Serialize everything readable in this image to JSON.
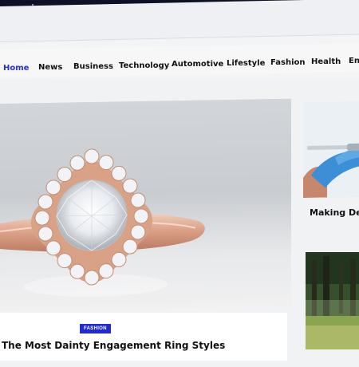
{
  "nav": {
    "items": [
      {
        "label": "Home",
        "active": true
      },
      {
        "label": "News"
      },
      {
        "label": "Business"
      },
      {
        "label": "Technology"
      },
      {
        "label": "Automotive"
      },
      {
        "label": "Lifestyle"
      },
      {
        "label": "Fashion"
      },
      {
        "label": "Health"
      },
      {
        "label": "Ent"
      }
    ]
  },
  "hero": {
    "category": "FASHION",
    "title": "The Most Dainty Engagement Ring Styles"
  },
  "side": {
    "card1_title": "Making Den"
  },
  "colors": {
    "accent": "#2330d8",
    "badge_bg": "#1f2ad6",
    "topbar": "#0c1126"
  }
}
